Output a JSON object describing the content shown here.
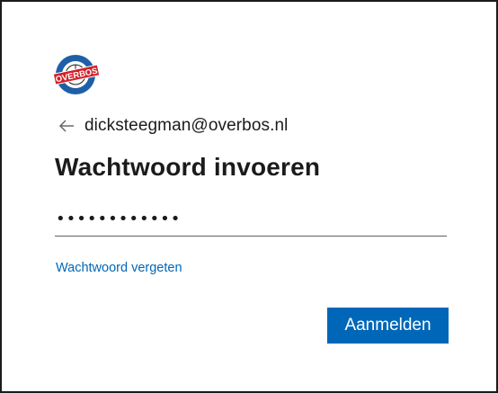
{
  "logo": {
    "banner_text": "OVERBOS",
    "colors": {
      "ring": "#1e5fa8",
      "banner": "#d21f26",
      "ball": "#1b1b1b"
    }
  },
  "identity": {
    "back_icon": "arrow-left-icon",
    "email": "dicksteegman@overbos.nl"
  },
  "title": "Wachtwoord invoeren",
  "password": {
    "value": "••••••••••••"
  },
  "forgot_link": "Wachtwoord vergeten",
  "signin_button": "Aanmelden",
  "colors": {
    "accent": "#0067b8",
    "text": "#1b1b1b",
    "border": "#1b1b1b"
  }
}
